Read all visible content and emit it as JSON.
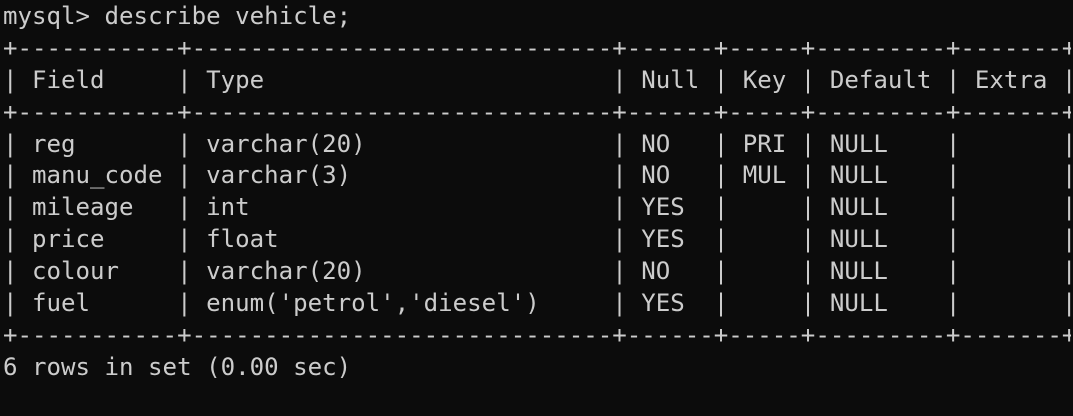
{
  "terminal": {
    "prompt": "mysql> ",
    "command": "describe vehicle;",
    "border": "+-----------+-----------------------------+------+-----+---------+-------+",
    "header": "| Field     | Type                        | Null | Key | Default | Extra |",
    "rows": [
      "| reg       | varchar(20)                 | NO   | PRI | NULL    |       |",
      "| manu_code | varchar(3)                  | NO   | MUL | NULL    |       |",
      "| mileage   | int                         | YES  |     | NULL    |       |",
      "| price     | float                       | YES  |     | NULL    |       |",
      "| colour    | varchar(20)                 | NO   |     | NULL    |       |",
      "| fuel      | enum('petrol','diesel')     | YES  |     | NULL    |       |"
    ],
    "summary": "6 rows in set (0.00 sec)"
  },
  "colors": {
    "background": "#0c0c0c",
    "text": "#cccccc"
  }
}
